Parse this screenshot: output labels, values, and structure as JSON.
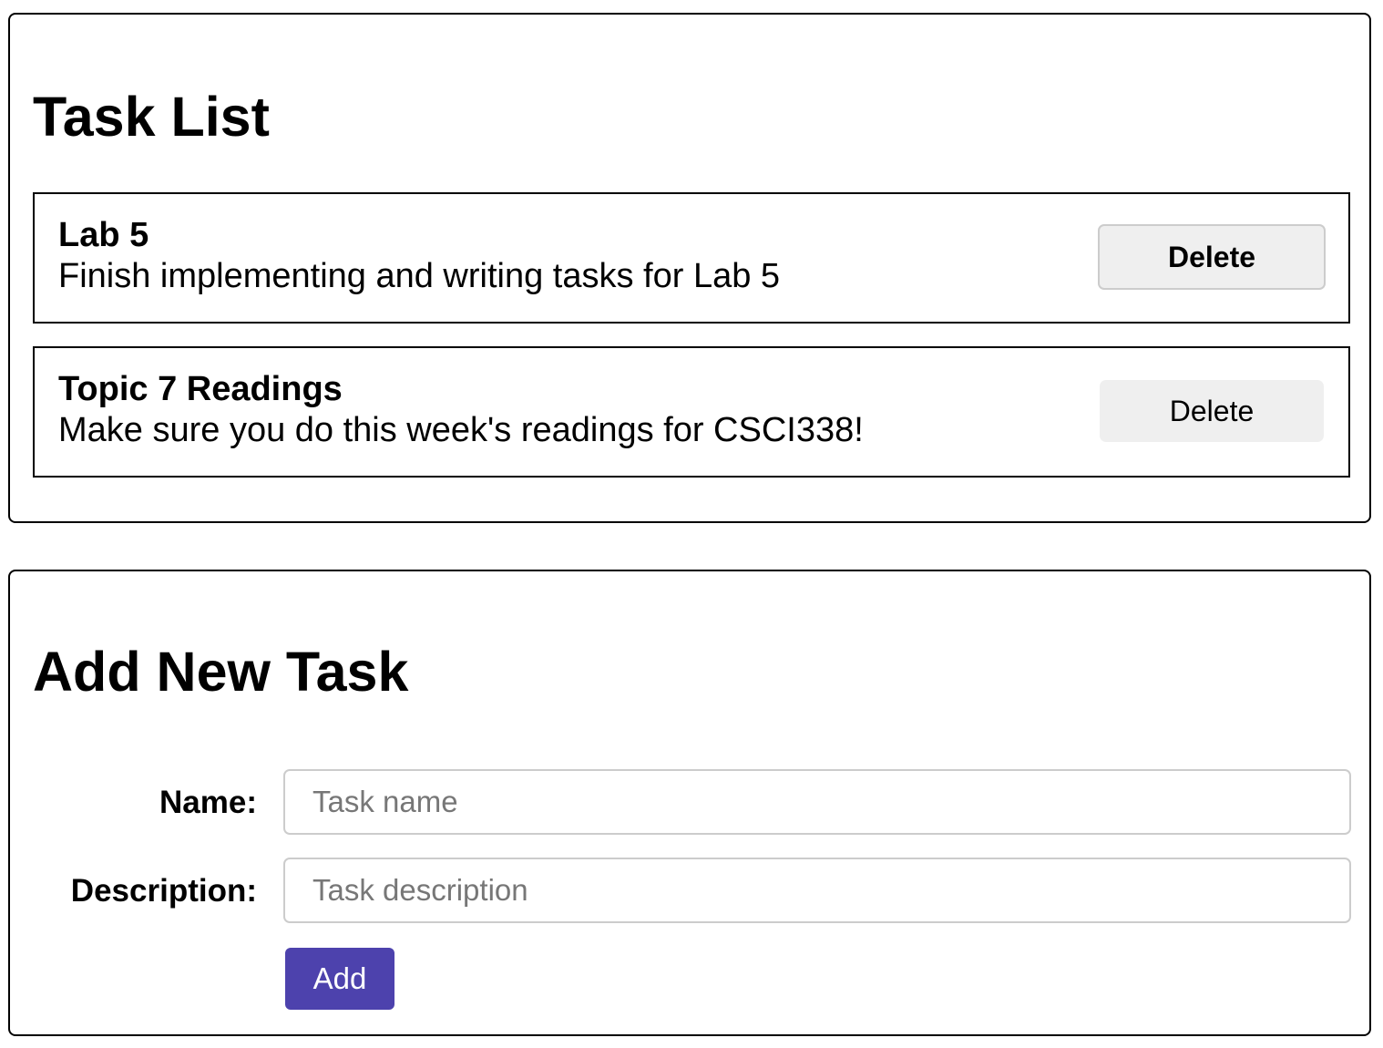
{
  "task_list": {
    "title": "Task List",
    "tasks": [
      {
        "name": "Lab 5",
        "description": "Finish implementing and writing tasks for Lab 5",
        "delete_label": "Delete"
      },
      {
        "name": "Topic 7 Readings",
        "description": "Make sure you do this week's readings for CSCI338!",
        "delete_label": "Delete"
      }
    ]
  },
  "add_task": {
    "title": "Add New Task",
    "name_label": "Name:",
    "name_placeholder": "Task name",
    "name_value": "",
    "description_label": "Description:",
    "description_placeholder": "Task description",
    "description_value": "",
    "add_label": "Add"
  },
  "colors": {
    "add_button": "#4d42ad",
    "delete_button": "#efefef",
    "border": "#000000"
  }
}
